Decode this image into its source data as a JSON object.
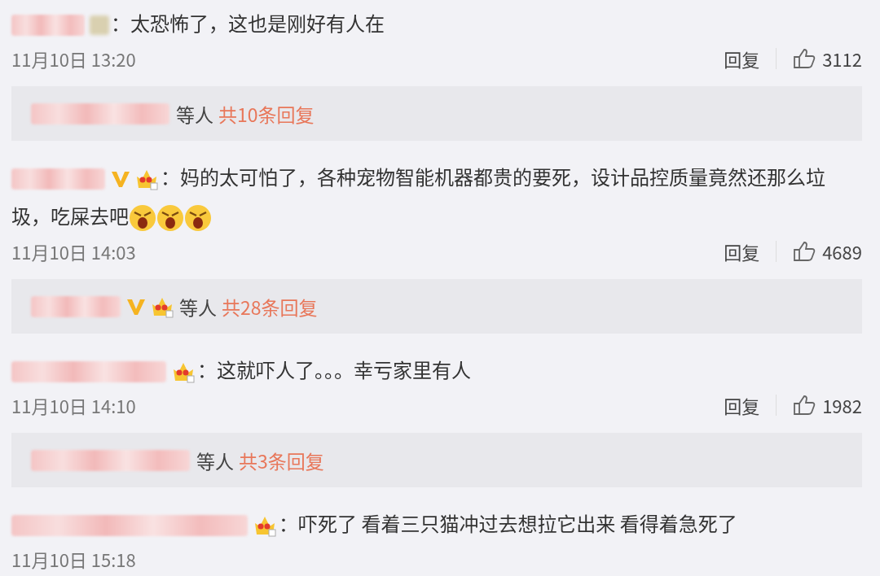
{
  "comments": [
    {
      "badges": [
        {
          "kind": "blurred"
        }
      ],
      "lines": [
        "：太恐怖了，这也是刚好有人在"
      ],
      "time": "11月10日 13:20",
      "reply": "回复",
      "likes": "3112",
      "thread": {
        "label": "等人",
        "count": "共10条回复"
      }
    },
    {
      "badges": [
        {
          "kind": "verified"
        },
        {
          "kind": "crown"
        }
      ],
      "lines": [
        "：妈的太可怕了，各种宠物智能机器都贵的要死，设计品控质量竟然还那么垃",
        "圾，吃屎去吧"
      ],
      "emojis": [
        {
          "kind": "angry"
        },
        {
          "kind": "angry"
        },
        {
          "kind": "angry"
        }
      ],
      "time": "11月10日 14:03",
      "reply": "回复",
      "likes": "4689",
      "thread": {
        "badges": [
          {
            "kind": "verified"
          },
          {
            "kind": "crown"
          }
        ],
        "label": "等人",
        "count": "共28条回复"
      }
    },
    {
      "badges": [
        {
          "kind": "crown"
        }
      ],
      "lines": [
        "：这就吓人了。。。幸亏家里有人"
      ],
      "time": "11月10日 14:10",
      "reply": "回复",
      "likes": "1982",
      "thread": {
        "label": "等人",
        "count": "共3条回复"
      }
    },
    {
      "badges": [
        {
          "kind": "crown"
        }
      ],
      "lines": [
        "：吓死了 看着三只猫冲过去想拉它出来 看得着急死了"
      ],
      "time": "11月10日 15:18"
    }
  ]
}
